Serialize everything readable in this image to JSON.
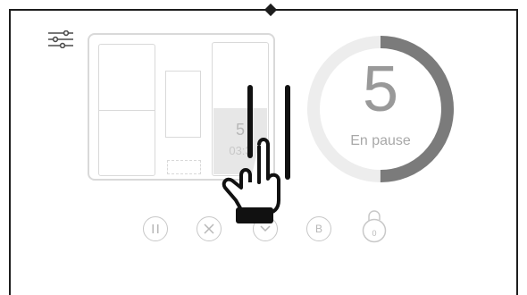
{
  "app": {
    "screen": "program-paused"
  },
  "icons": {
    "settings": "settings-sliders-icon",
    "pause": "pause-icon",
    "cancel": "cancel-icon",
    "confirm": "chevron-down-icon",
    "b_button": "b-icon",
    "lock": "lock-icon",
    "gesture": "two-finger-swipe-hand-icon"
  },
  "appliance": {
    "highlighted_count": "5",
    "highlighted_time": "03:3"
  },
  "timer": {
    "value": "5",
    "status": "En pause",
    "progress_fraction": 0.5,
    "track_color": "#ededed",
    "progress_color": "#7b7b7b"
  },
  "controls": {
    "b_label": "B",
    "lock_label": "0"
  }
}
